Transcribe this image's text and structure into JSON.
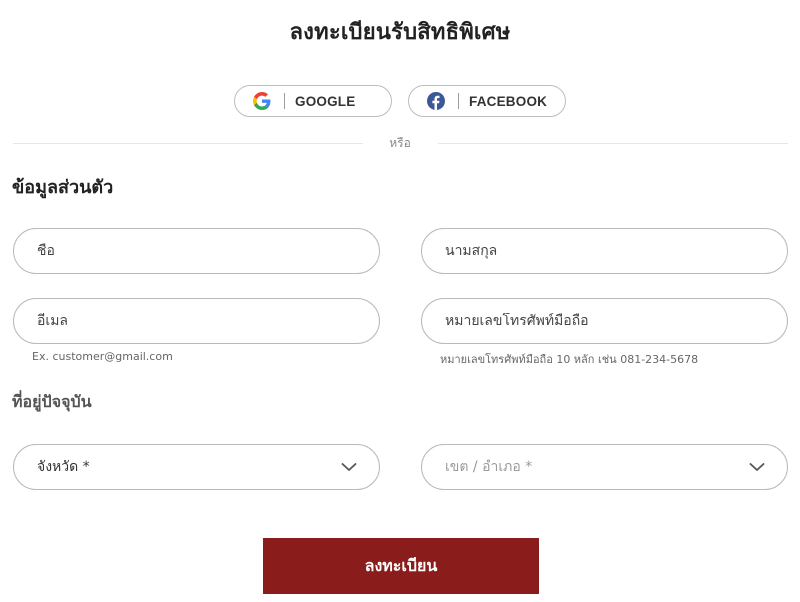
{
  "header": {
    "title": "ลงทะเบียนรับสิทธิพิเศษ"
  },
  "social": {
    "google_label": "GOOGLE",
    "google_icon": "google-icon",
    "facebook_label": "FACEBOOK",
    "facebook_icon": "facebook-icon",
    "facebook_color": "#3b5998"
  },
  "divider": {
    "or_text": "หรือ"
  },
  "personal": {
    "section_title": "ข้อมูลส่วนตัว",
    "first_name_placeholder": "ชื่อ",
    "last_name_placeholder": "นามสกุล",
    "email_placeholder": "อีเมล",
    "phone_placeholder": "หมายเลขโทรศัพท์มือถือ",
    "email_hint": "Ex. customer@gmail.com",
    "phone_hint": "หมายเลขโทรศัพท์มือถือ 10 หลัก เช่น 081-234-5678"
  },
  "address": {
    "section_title": "ที่อยู่ปัจจุบัน",
    "province_label": "จังหวัด *",
    "district_label": "เขต / อำเภอ *",
    "chevron_icon": "chevron-down-icon"
  },
  "actions": {
    "submit_label": "ลงทะเบียน",
    "submit_color": "#8b1c1c"
  }
}
